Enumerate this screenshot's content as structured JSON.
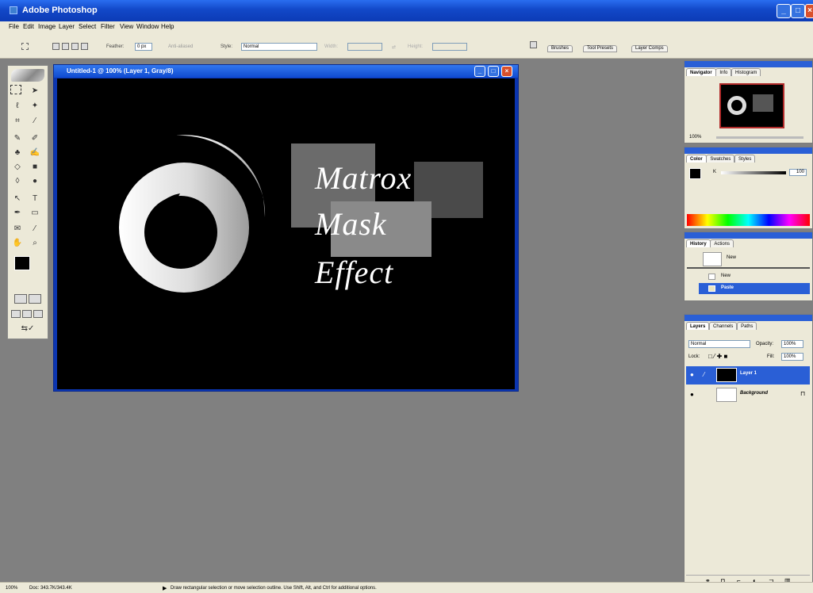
{
  "window": {
    "title": "Adobe Photoshop"
  },
  "menu": [
    "File",
    "Edit",
    "Image",
    "Layer",
    "Select",
    "Filter",
    "View",
    "Window",
    "Help"
  ],
  "options": {
    "feather_label": "Feather:",
    "feather_value": "0 px",
    "antialiased_label": "Anti-aliased",
    "style_label": "Style:",
    "style_value": "Normal",
    "width_label": "Width:",
    "height_label": "Height:",
    "palette_tabs": [
      "Brushes",
      "Tool Presets",
      "Layer Comps"
    ]
  },
  "document": {
    "title": "Untitled-1 @ 100% (Layer 1, Gray/8)",
    "text_lines": [
      "Matrox",
      "Mask",
      "Effect"
    ],
    "colors": {
      "background": "#000000",
      "rect_light": "#6b6b6b",
      "rect_dark": "#4a4a4a",
      "rect_mid": "#8a8a8a"
    }
  },
  "navigator": {
    "tabs": [
      "Navigator",
      "Info",
      "Histogram"
    ],
    "zoom": "100%"
  },
  "color_panel": {
    "tabs": [
      "Color",
      "Swatches",
      "Styles"
    ],
    "channel": "K",
    "value": "100"
  },
  "history": {
    "tabs": [
      "History",
      "Actions"
    ],
    "snapshot": "New",
    "items": [
      "New",
      "Paste"
    ],
    "active_index": 1
  },
  "layers": {
    "tabs": [
      "Layers",
      "Channels",
      "Paths"
    ],
    "blend_mode": "Normal",
    "opacity_label": "Opacity:",
    "opacity": "100%",
    "lock_label": "Lock:",
    "fill_label": "Fill:",
    "fill": "100%",
    "rows": [
      {
        "name": "Layer 1",
        "selected": true
      },
      {
        "name": "Background",
        "selected": false
      }
    ]
  },
  "status": {
    "zoom": "100%",
    "doc": "Doc: 343.7K/343.4K",
    "message": "Draw rectangular selection or move selection outline.  Use Shift, Alt, and Ctrl for additional options."
  },
  "icons": [
    "photoshop-app-icon",
    "minimize-icon",
    "maximize-icon",
    "close-icon",
    "marquee-icon",
    "move-icon",
    "lasso-icon",
    "magic-wand-icon",
    "crop-icon",
    "slice-icon",
    "brush-icon",
    "stamp-icon",
    "eraser-icon",
    "gradient-icon",
    "pen-icon",
    "type-icon",
    "hand-icon",
    "zoom-icon",
    "eye-icon",
    "brush-link-icon",
    "lock-icon"
  ]
}
